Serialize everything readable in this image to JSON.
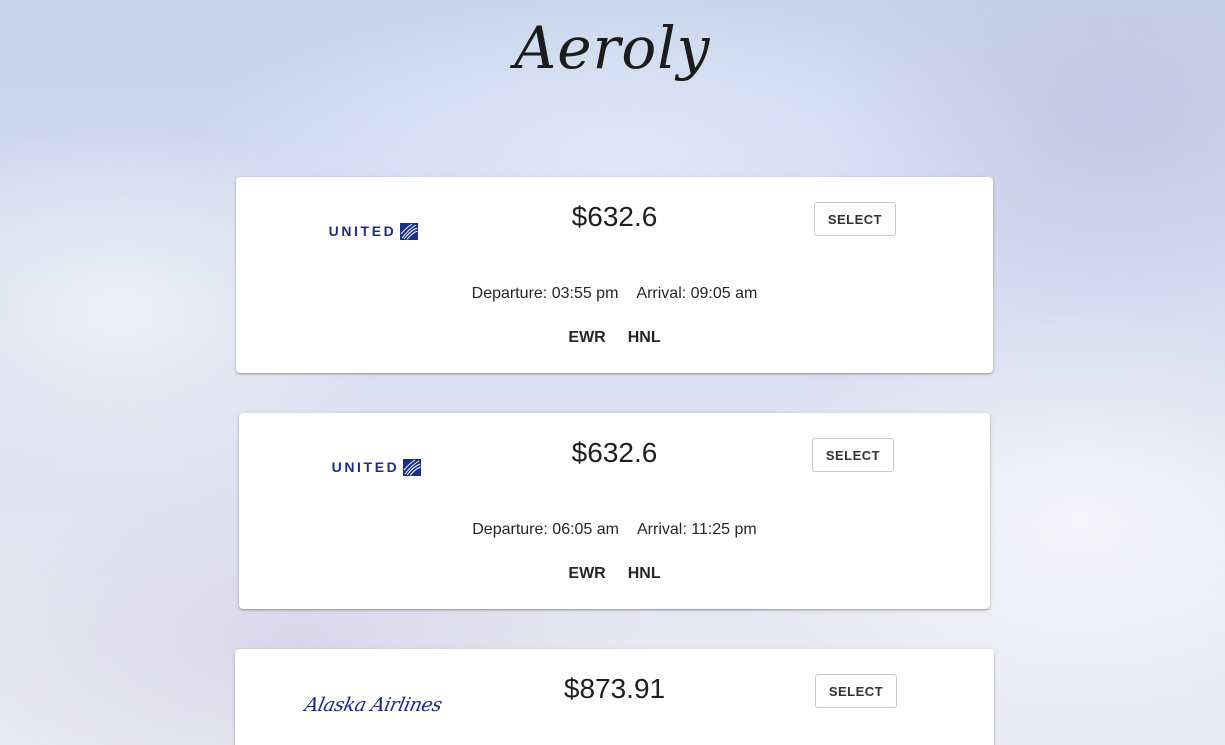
{
  "app": {
    "title": "Aeroly"
  },
  "flights": [
    {
      "airline": "UNITED",
      "price": "$632.6",
      "select_label": "SELECT",
      "departure": "Departure: 03:55 pm",
      "arrival": "Arrival: 09:05 am",
      "origin": "EWR",
      "destination": "HNL"
    },
    {
      "airline": "UNITED",
      "price": "$632.6",
      "select_label": "SELECT",
      "departure": "Departure: 06:05 am",
      "arrival": "Arrival: 11:25 pm",
      "origin": "EWR",
      "destination": "HNL"
    },
    {
      "airline": "Alaska Airlines",
      "price": "$873.91",
      "select_label": "SELECT"
    }
  ],
  "colors": {
    "united_blue": "#1a2f8c",
    "alaska_blue": "#1b2a8e",
    "card_background": "#ffffff"
  },
  "icons": {
    "united_logo": "united-globe-icon",
    "alaska_logo": "alaska-wordmark"
  }
}
